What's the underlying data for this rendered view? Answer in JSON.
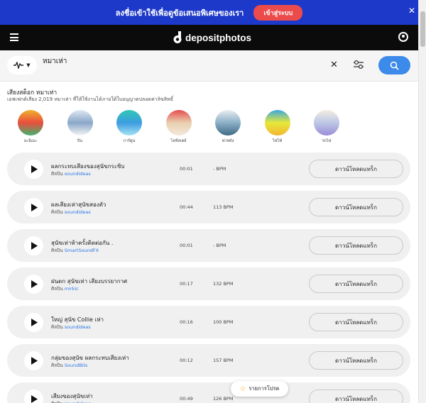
{
  "promo": {
    "text": "ลงชื่อเข้าใช้เพื่อดูข้อเสนอพิเศษของเรา",
    "button": "เข้าสู่ระบบ",
    "close": "✕"
  },
  "header": {
    "brand": "depositphotos"
  },
  "search": {
    "type_icon": "waveform-icon",
    "query": "หมาเห่า",
    "placeholder": ""
  },
  "page": {
    "heading": "เสียงสต็อก หมาเห่า",
    "subheading": "เอฟเฟกต์เสียง 2,019 หมาเห่า ที่ให้ใช้งานได้ภายใต้ใบอนุญาตปลอดค่าลิขสิทธิ์"
  },
  "genres": [
    {
      "label": "อะนิเมะ",
      "gradient": [
        "#f0b12b",
        "#e94e3d",
        "#3fb56f"
      ]
    },
    {
      "label": "บีน",
      "gradient": [
        "#dfe8f2",
        "#8aa7c9",
        "#f5f5f5"
      ]
    },
    {
      "label": "การ์ตูน",
      "gradient": [
        "#2fc7b5",
        "#3c9de0",
        "#a6e3f5"
      ]
    },
    {
      "label": "ไลฟ์สเตย์",
      "gradient": [
        "#e64d4d",
        "#e8d0b0",
        "#f4e8dc"
      ]
    },
    {
      "label": "ฟาทดัง",
      "gradient": [
        "#e9edf0",
        "#8bb0c7",
        "#3f6a86"
      ]
    },
    {
      "label": "ไฟไฟ้",
      "gradient": [
        "#3aa6e0",
        "#e6e93a",
        "#f3b52e"
      ]
    },
    {
      "label": "รถไฟ",
      "gradient": [
        "#f4ede1",
        "#bcc8e6",
        "#9b8bd9"
      ]
    }
  ],
  "artist_prefix": "ศิลปิน",
  "download_label": "ดาวน์โหลดแทร็ก",
  "tracks": [
    {
      "title": "ผลกระทบเสียงของสุนัขกระซิบ",
      "artist": "soundideas",
      "duration": "00:01",
      "bpm": "- BPM"
    },
    {
      "title": "ผลเสียงเห่าสุนัขสองตัว",
      "artist": "soundideas",
      "duration": "00:44",
      "bpm": "113 BPM"
    },
    {
      "title": "สุนัขเห่าห้าครั้งติดต่อกัน .",
      "artist": "SmartSoundFX",
      "duration": "00:01",
      "bpm": "- BPM"
    },
    {
      "title": "ฝนตก สุนัขเห่า เสียงบรรยากาศ",
      "artist": "mirkic",
      "duration": "00:17",
      "bpm": "132 BPM"
    },
    {
      "title": "ใหญ่ สุนัข Collie เห่า",
      "artist": "soundideas",
      "duration": "00:16",
      "bpm": "100 BPM"
    },
    {
      "title": "กลุ่มของสุนัข ผลกระทบเสียงเห่า",
      "artist": "SoundBits",
      "duration": "00:12",
      "bpm": "157 BPM"
    },
    {
      "title": "เสียงของสุนัขเห่า",
      "artist": "soundideas",
      "duration": "00:49",
      "bpm": "126 BPM"
    }
  ],
  "favorites": {
    "label": "รายการโปรด"
  }
}
